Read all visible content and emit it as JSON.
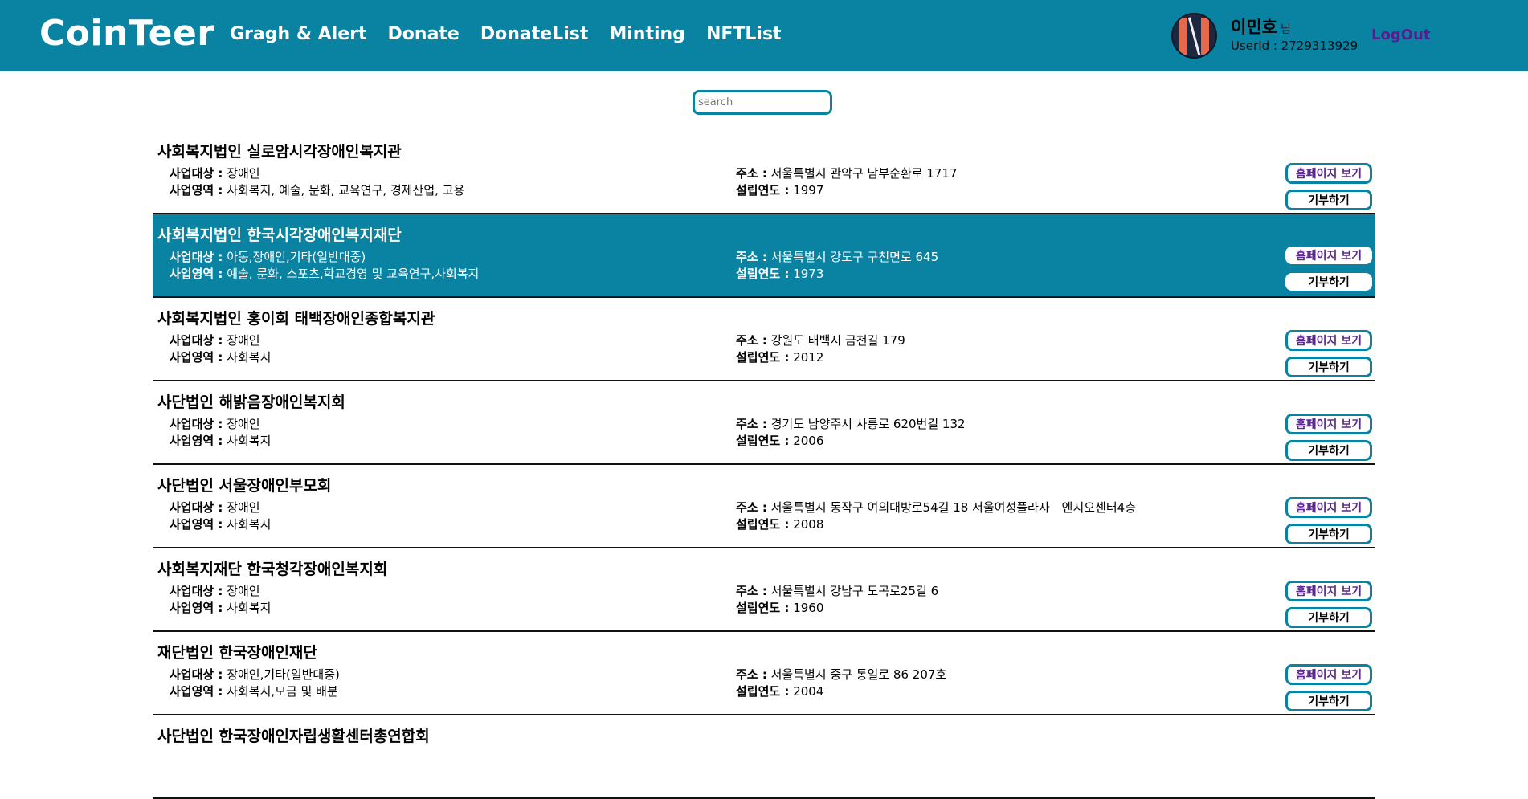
{
  "header": {
    "logo": "CoinTeer",
    "nav": [
      "Gragh & Alert",
      "Donate",
      "DonateList",
      "Minting",
      "NFTList"
    ],
    "user_name": "이민호",
    "user_suffix": "님",
    "user_id": "UserId : 2729313929",
    "logout": "LogOut"
  },
  "search": {
    "placeholder": "search"
  },
  "labels": {
    "target": "사업대상 :",
    "area": "사업영역 :",
    "address": "주소 :",
    "year": "설립연도 :",
    "homepage": "홈페이지 보기",
    "donate": "기부하기"
  },
  "orgs": [
    {
      "name": "사회복지법인 실로암시각장애인복지관",
      "target": "장애인",
      "area": "사회복지, 예술, 문화, 교육연구, 경제산업, 고용",
      "address": "서울특별시 관악구 남부순환로 1717",
      "year": "1997"
    },
    {
      "name": "사회복지법인 한국시각장애인복지재단",
      "target": "아동,장애인,기타(일반대중)",
      "area": "예술, 문화, 스포츠,학교경영 및 교육연구,사회복지",
      "address": "서울특별시 강도구 구천면로 645",
      "year": "1973"
    },
    {
      "name": "사회복지법인 홍이회 태백장애인종합복지관",
      "target": "장애인",
      "area": "사회복지",
      "address": "강원도 태백시 금천길 179",
      "year": "2012"
    },
    {
      "name": "사단법인 해밝음장애인복지회",
      "target": "장애인",
      "area": "사회복지",
      "address": "경기도 남양주시 사릉로 620번길 132",
      "year": "2006"
    },
    {
      "name": "사단법인 서울장애인부모회",
      "target": "장애인",
      "area": "사회복지",
      "address": "서울특별시 동작구 여의대방로54길 18 서울여성플라자　엔지오센터4층",
      "year": "2008"
    },
    {
      "name": "사회복지재단 한국청각장애인복지회",
      "target": "장애인",
      "area": "사회복지",
      "address": "서울특별시 강남구 도곡로25길 6",
      "year": "1960"
    },
    {
      "name": "재단법인 한국장애인재단",
      "target": "장애인,기타(일반대중)",
      "area": "사회복지,모금 및 배분",
      "address": "서울특별시 중구 통일로 86 207호",
      "year": "2004"
    },
    {
      "name": "사단법인 한국장애인자립생활센터총연합회"
    }
  ]
}
